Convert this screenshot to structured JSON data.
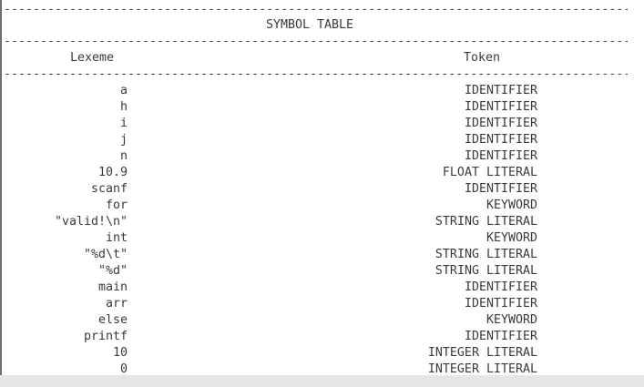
{
  "terminal": {
    "separator": "----------------------------------------------------------------------------------------------------------------",
    "title": "SYMBOL TABLE",
    "columns": {
      "lexeme": "Lexeme",
      "token": "Token"
    },
    "rows": [
      {
        "lexeme": "a",
        "token": "IDENTIFIER"
      },
      {
        "lexeme": "h",
        "token": "IDENTIFIER"
      },
      {
        "lexeme": "i",
        "token": "IDENTIFIER"
      },
      {
        "lexeme": "j",
        "token": "IDENTIFIER"
      },
      {
        "lexeme": "n",
        "token": "IDENTIFIER"
      },
      {
        "lexeme": "10.9",
        "token": "FLOAT LITERAL"
      },
      {
        "lexeme": "scanf",
        "token": "IDENTIFIER"
      },
      {
        "lexeme": "for",
        "token": "KEYWORD"
      },
      {
        "lexeme": "\"valid!\\n\"",
        "token": "STRING LITERAL"
      },
      {
        "lexeme": "int",
        "token": "KEYWORD"
      },
      {
        "lexeme": "\"%d\\t\"",
        "token": "STRING LITERAL"
      },
      {
        "lexeme": "\"%d\"",
        "token": "STRING LITERAL"
      },
      {
        "lexeme": "main",
        "token": "IDENTIFIER"
      },
      {
        "lexeme": "arr",
        "token": "IDENTIFIER"
      },
      {
        "lexeme": "else",
        "token": "KEYWORD"
      },
      {
        "lexeme": "printf",
        "token": "IDENTIFIER"
      },
      {
        "lexeme": "10",
        "token": "INTEGER LITERAL"
      },
      {
        "lexeme": "0",
        "token": "INTEGER LITERAL"
      }
    ]
  },
  "colors": {
    "text": "#3a3a3a",
    "background": "#ffffff",
    "bottom_strip": "#e6e6e6",
    "left_border": "#6f6f6f"
  }
}
